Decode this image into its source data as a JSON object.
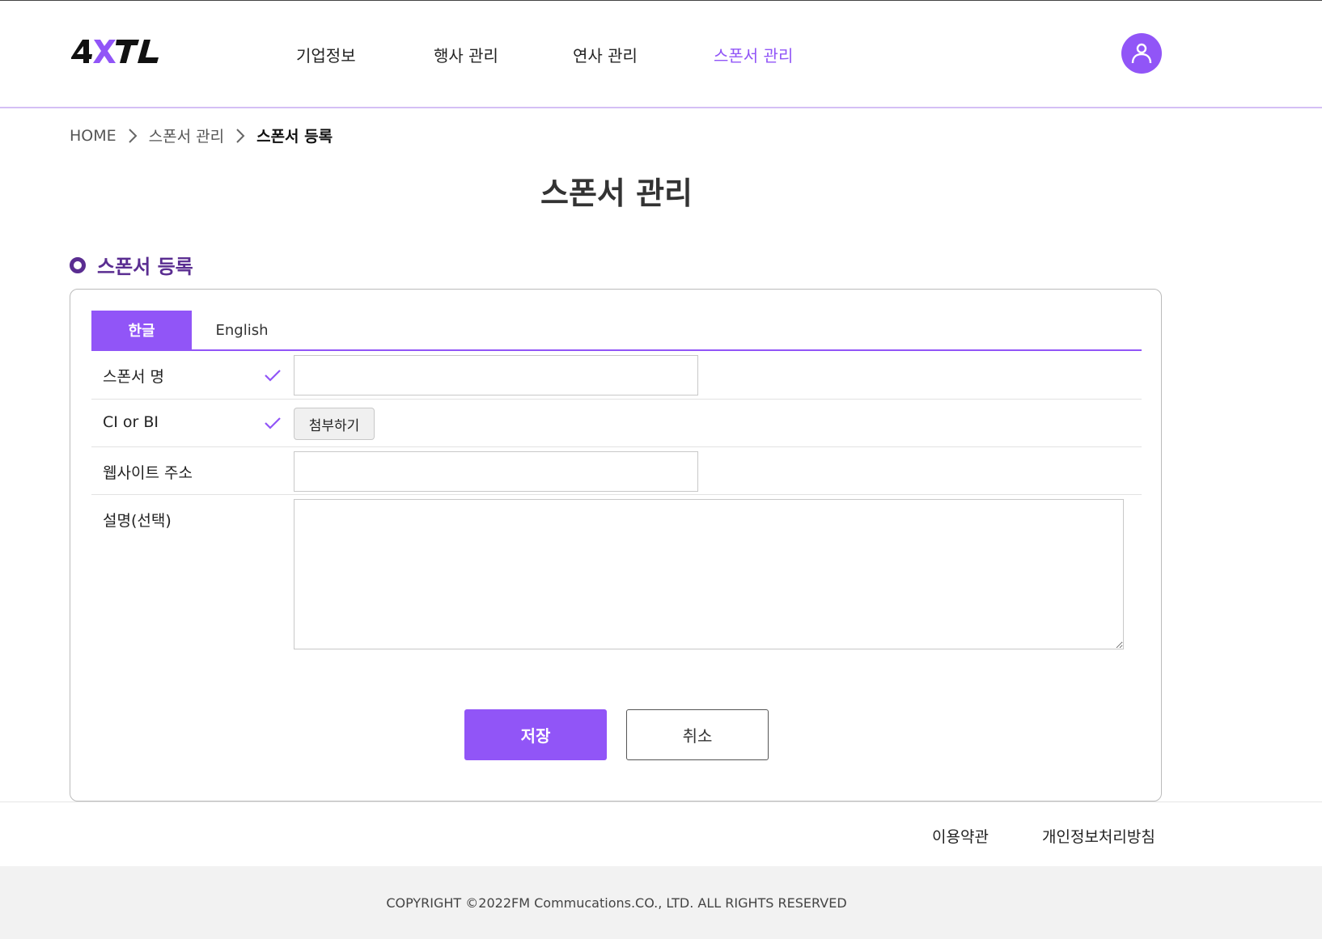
{
  "brand": {
    "logo_text": "4XTL",
    "accent_color": "#9155f7",
    "accent_dark": "#5a2d91"
  },
  "nav": {
    "items": [
      {
        "label": "기업정보"
      },
      {
        "label": "행사 관리"
      },
      {
        "label": "연사 관리"
      },
      {
        "label": "스폰서 관리",
        "active": true
      }
    ],
    "avatar_icon": "user-icon"
  },
  "breadcrumb": {
    "items": [
      "HOME",
      "스폰서 관리",
      "스폰서 등록"
    ],
    "separator_icon": "chevron-right-icon"
  },
  "page": {
    "title": "스폰서 관리"
  },
  "section": {
    "title": "스폰서 등록"
  },
  "tabs": [
    {
      "label": "한글",
      "active": true
    },
    {
      "label": "English",
      "active": false
    }
  ],
  "form": {
    "sponsor_name": {
      "label": "스폰서 명",
      "required": true,
      "value": ""
    },
    "ci_bi": {
      "label": "CI or BI",
      "required": true,
      "button_label": "첨부하기"
    },
    "website": {
      "label": "웹사이트 주소",
      "value": ""
    },
    "description": {
      "label": "설명(선택)",
      "value": ""
    }
  },
  "actions": {
    "save_label": "저장",
    "cancel_label": "취소"
  },
  "footer": {
    "links": [
      "이용약관",
      "개인정보처리방침"
    ],
    "copyright": "COPYRIGHT ©2022FM Commucations.CO., LTD. ALL RIGHTS RESERVED"
  }
}
